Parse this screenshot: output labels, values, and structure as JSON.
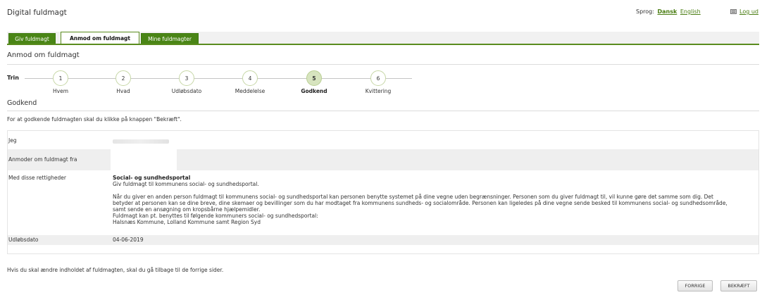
{
  "header": {
    "app_title": "Digital fuldmagt",
    "language_label": "Sprog:",
    "language_active": "Dansk",
    "language_other": "English",
    "logout": "Log ud"
  },
  "tabs": [
    {
      "label": "Giv fuldmagt"
    },
    {
      "label": "Anmod om fuldmagt",
      "active": true
    },
    {
      "label": "Mine fuldmagter"
    }
  ],
  "page_heading": "Anmod om fuldmagt",
  "stepper": {
    "label": "Trin",
    "current_step": 5,
    "steps": [
      {
        "number": "1",
        "label": "Hvem"
      },
      {
        "number": "2",
        "label": "Hvad"
      },
      {
        "number": "3",
        "label": "Udløbsdato"
      },
      {
        "number": "4",
        "label": "Meddelelse"
      },
      {
        "number": "5",
        "label": "Godkend"
      },
      {
        "number": "6",
        "label": "Kvittering"
      }
    ]
  },
  "section_title": "Godkend",
  "instruction": "For at godkende fuldmagten skal du klikke på knappen \"Bekræft\".",
  "summary": {
    "me_label": "Jeg",
    "requester_label": "Anmoder om fuldmagt fra",
    "rights_label": "Med disse rettigheder",
    "rights_title": "Social- og sundhedsportal",
    "rights_subtitle": "Giv fuldmagt til kommunens social- og sundhedsportal.",
    "rights_desc_1": "Når du giver en anden person fuldmagt til kommunens social- og sundhedsportal kan personen benytte systemet på dine vegne uden begrænsninger. Personen som du giver fuldmagt til, vil kunne gøre det samme som dig. Det betyder at personen kan se dine breve, dine skemaer og bevillinger som du har modtaget fra kommunens sundheds- og socialområde. Personen kan ligeledes på dine vegne sende besked til kommunens social- og sundhedsområde, samt sende en ansøgning om kropsbårne hjælpemidler.",
    "rights_desc_2": "Fuldmagt kan pt. benyttes til følgende kommuners social- og sundhedsportal:",
    "rights_desc_3": "Halsnæs Kommune, Lolland Kommune samt Region Syd",
    "expiry_label": "Udløbsdato",
    "expiry_value": "04-06-2019"
  },
  "bottom_note": "Hvis du skal ændre indholdet af fuldmagten, skal du gå tilbage til de forrige sider.",
  "buttons": {
    "back": "FORRIGE",
    "confirm": "BEKRÆFT"
  }
}
